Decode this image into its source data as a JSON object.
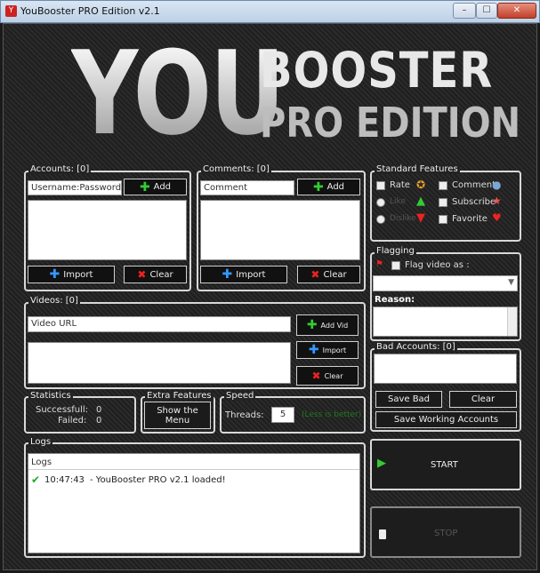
{
  "window": {
    "title": "YouBooster PRO Edition v2.1",
    "min": "–",
    "max": "☐",
    "close": "✕"
  },
  "logo": {
    "line1": "YOU",
    "line2": "BOOSTER",
    "line3": "PRO EDITION"
  },
  "accounts": {
    "title": "Accounts: [0]",
    "input_value": "Username:Password",
    "add": "Add",
    "import": "Import",
    "clear": "Clear"
  },
  "comments": {
    "title": "Comments: [0]",
    "input_value": "Comment",
    "add": "Add",
    "import": "Import",
    "clear": "Clear"
  },
  "standard": {
    "title": "Standard Features",
    "rate": "Rate",
    "comment": "Comment",
    "like": "Like",
    "subscribe": "Subscribe",
    "dislike": "Dislike",
    "favorite": "Favorite"
  },
  "flagging": {
    "title": "Flagging",
    "flag_label": "Flag video as :",
    "reason": "Reason:"
  },
  "videos": {
    "title": "Videos: [0]",
    "input_value": "Video URL",
    "add": "Add Vid",
    "import": "Import",
    "clear": "Clear"
  },
  "bad_accounts": {
    "title": "Bad Accounts: [0]",
    "save_bad": "Save Bad",
    "clear": "Clear",
    "save_working": "Save Working Accounts"
  },
  "statistics": {
    "title": "Statistics",
    "successful_label": "Successfull:",
    "successful_value": "0",
    "failed_label": "Failed:",
    "failed_value": "0"
  },
  "extra": {
    "title": "Extra Features",
    "menu": "Show the Menu"
  },
  "speed": {
    "title": "Speed",
    "threads_label": "Threads:",
    "threads_value": "5",
    "hint": "(Less is better)"
  },
  "logs": {
    "title": "Logs",
    "header": "Logs",
    "entries": [
      {
        "time": "10:47:43",
        "text": "- YouBooster PRO v2.1 loaded!"
      }
    ]
  },
  "controls": {
    "start": "START",
    "stop": "STOP"
  }
}
